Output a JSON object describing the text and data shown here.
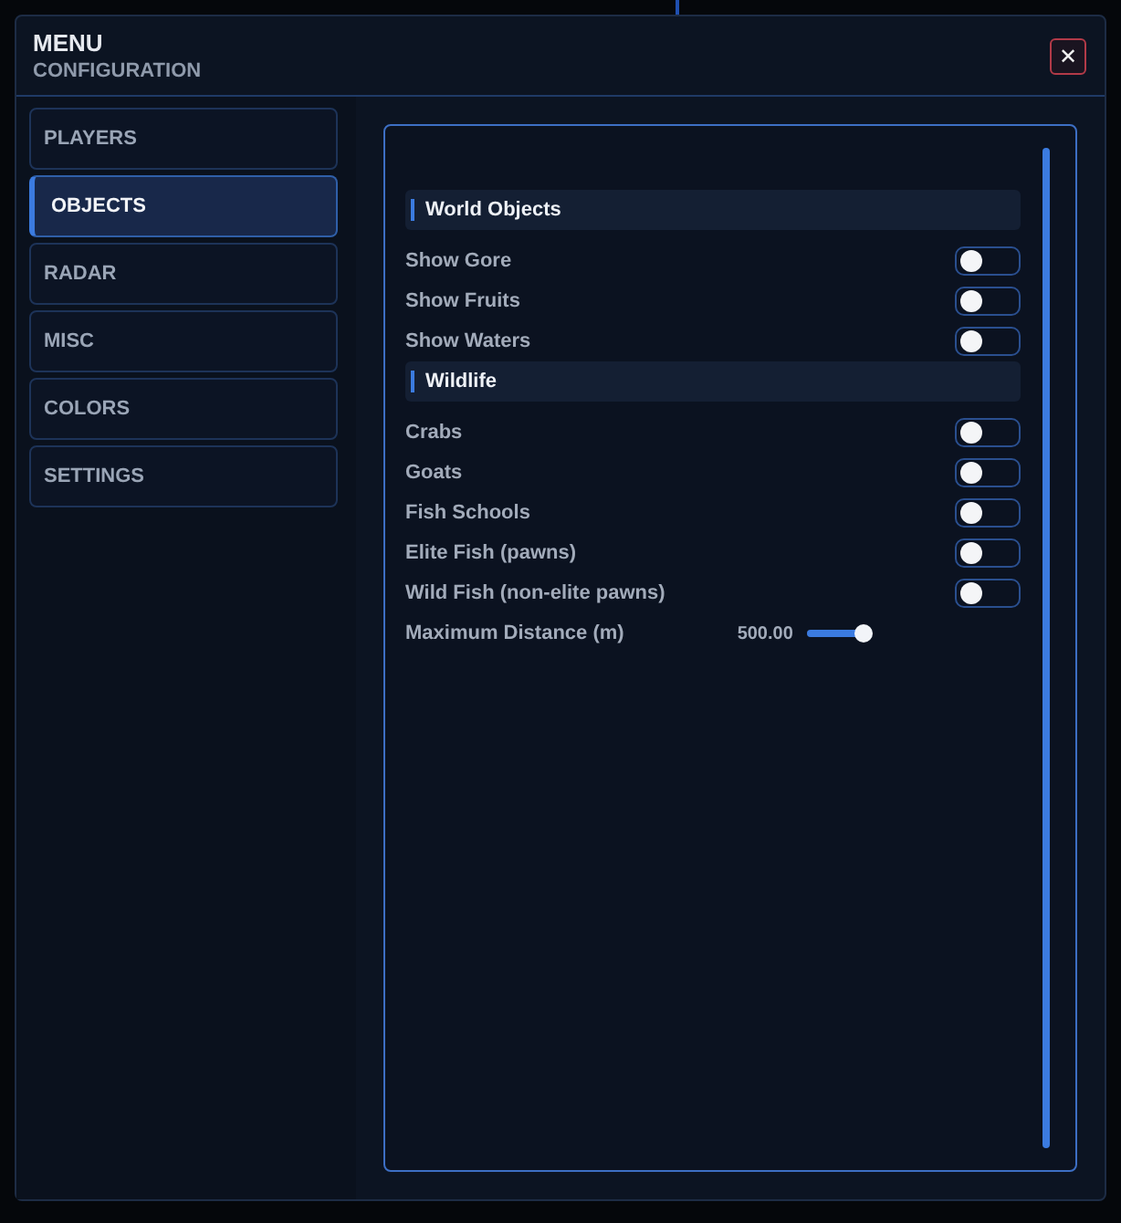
{
  "window": {
    "title": "MENU",
    "subtitle": "CONFIGURATION",
    "close": "✕"
  },
  "sidebar": {
    "items": [
      {
        "label": "PLAYERS",
        "selected": false
      },
      {
        "label": "OBJECTS",
        "selected": true
      },
      {
        "label": "RADAR",
        "selected": false
      },
      {
        "label": "MISC",
        "selected": false
      },
      {
        "label": "COLORS",
        "selected": false
      },
      {
        "label": "SETTINGS",
        "selected": false
      }
    ]
  },
  "sections": [
    {
      "title": "World Objects",
      "rows": [
        {
          "kind": "toggle",
          "label": "Show Gore",
          "on": false
        },
        {
          "kind": "toggle",
          "label": "Show Fruits",
          "on": false
        },
        {
          "kind": "toggle",
          "label": "Show Waters",
          "on": false
        }
      ]
    },
    {
      "title": "Wildlife",
      "rows": [
        {
          "kind": "toggle",
          "label": "Crabs",
          "on": false
        },
        {
          "kind": "toggle",
          "label": "Goats",
          "on": false
        },
        {
          "kind": "toggle",
          "label": "Fish Schools",
          "on": false
        },
        {
          "kind": "toggle",
          "label": "Elite Fish (pawns)",
          "on": false
        },
        {
          "kind": "toggle",
          "label": "Wild Fish (non-elite pawns)",
          "on": false
        },
        {
          "kind": "slider",
          "label": "Maximum Distance (m)",
          "reading": "500.00",
          "level": 0.85
        }
      ]
    }
  ]
}
